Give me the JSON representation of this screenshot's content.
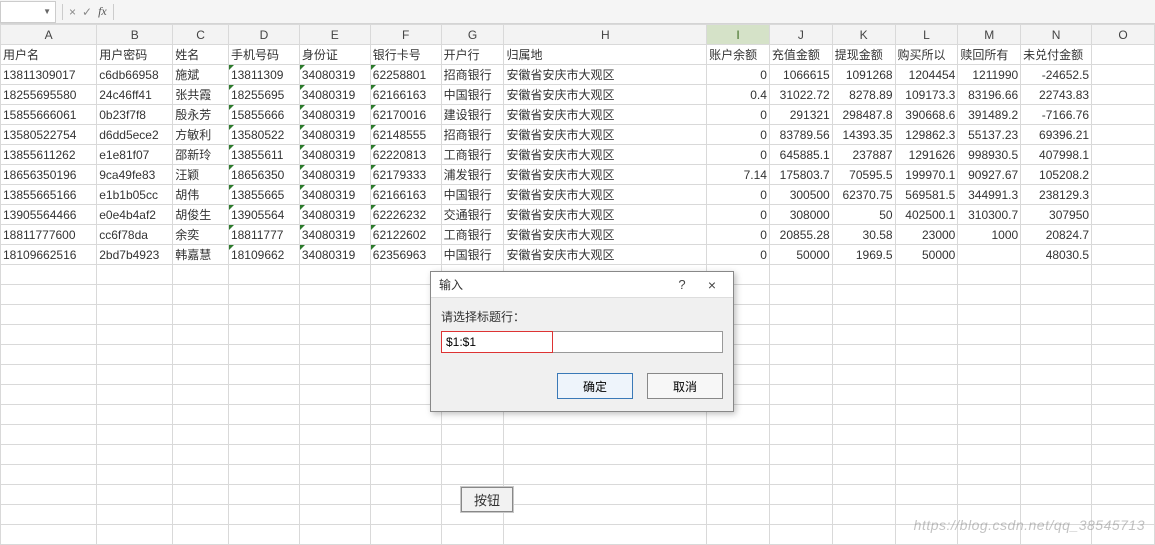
{
  "formula_bar": {
    "name_box": "",
    "fx_label": "fx",
    "cancel_glyph": "×",
    "accept_glyph": "✓"
  },
  "columns": [
    "A",
    "B",
    "C",
    "D",
    "E",
    "F",
    "G",
    "H",
    "I",
    "J",
    "K",
    "L",
    "M",
    "N",
    "O"
  ],
  "selected_column": "I",
  "headers": {
    "A": "用户名",
    "B": "用户密码",
    "C": "姓名",
    "D": "手机号码",
    "E": "身份证",
    "F": "银行卡号",
    "G": "开户行",
    "H": "归属地",
    "I": "账户余额",
    "J": "充值金额",
    "K": "提现金额",
    "L": "购买所以",
    "M": "赎回所有",
    "N": "未兑付金额"
  },
  "rows": [
    {
      "A": "13811309017",
      "B": "c6db66958",
      "C": "施斌",
      "D": "13811309",
      "E": "34080319",
      "F": "62258801",
      "G": "招商银行",
      "H": "安徽省安庆市大观区",
      "I": "0",
      "J": "1066615",
      "K": "1091268",
      "L": "1204454",
      "M": "1211990",
      "N": "-24652.5"
    },
    {
      "A": "18255695580",
      "B": "24c46ff41",
      "C": "张共霞",
      "D": "18255695",
      "E": "34080319",
      "F": "62166163",
      "G": "中国银行",
      "H": "安徽省安庆市大观区",
      "I": "0.4",
      "J": "31022.72",
      "K": "8278.89",
      "L": "109173.3",
      "M": "83196.66",
      "N": "22743.83"
    },
    {
      "A": "15855666061",
      "B": "0b23f7f8",
      "C": "殷永芳",
      "D": "15855666",
      "E": "34080319",
      "F": "62170016",
      "G": "建设银行",
      "H": "安徽省安庆市大观区",
      "I": "0",
      "J": "291321",
      "K": "298487.8",
      "L": "390668.6",
      "M": "391489.2",
      "N": "-7166.76"
    },
    {
      "A": "13580522754",
      "B": "d6dd5ece2",
      "C": "方敏利",
      "D": "13580522",
      "E": "34080319",
      "F": "62148555",
      "G": "招商银行",
      "H": "安徽省安庆市大观区",
      "I": "0",
      "J": "83789.56",
      "K": "14393.35",
      "L": "129862.3",
      "M": "55137.23",
      "N": "69396.21"
    },
    {
      "A": "13855611262",
      "B": "e1e81f07",
      "C": "邵新玲",
      "D": "13855611",
      "E": "34080319",
      "F": "62220813",
      "G": "工商银行",
      "H": "安徽省安庆市大观区",
      "I": "0",
      "J": "645885.1",
      "K": "237887",
      "L": "1291626",
      "M": "998930.5",
      "N": "407998.1"
    },
    {
      "A": "18656350196",
      "B": "9ca49fe83",
      "C": "汪颖",
      "D": "18656350",
      "E": "34080319",
      "F": "62179333",
      "G": "浦发银行",
      "H": "安徽省安庆市大观区",
      "I": "7.14",
      "J": "175803.7",
      "K": "70595.5",
      "L": "199970.1",
      "M": "90927.67",
      "N": "105208.2"
    },
    {
      "A": "13855665166",
      "B": "e1b1b05cc",
      "C": "胡伟",
      "D": "13855665",
      "E": "34080319",
      "F": "62166163",
      "G": "中国银行",
      "H": "安徽省安庆市大观区",
      "I": "0",
      "J": "300500",
      "K": "62370.75",
      "L": "569581.5",
      "M": "344991.3",
      "N": "238129.3"
    },
    {
      "A": "13905564466",
      "B": "e0e4b4af2",
      "C": "胡俊生",
      "D": "13905564",
      "E": "34080319",
      "F": "62226232",
      "G": "交通银行",
      "H": "安徽省安庆市大观区",
      "I": "0",
      "J": "308000",
      "K": "50",
      "L": "402500.1",
      "M": "310300.7",
      "N": "307950"
    },
    {
      "A": "18811777600",
      "B": "cc6f78da",
      "C": "余奕",
      "D": "18811777",
      "E": "34080319",
      "F": "62122602",
      "G": "工商银行",
      "H": "安徽省安庆市大观区",
      "I": "0",
      "J": "20855.28",
      "K": "30.58",
      "L": "23000",
      "M": "1000",
      "N": "20824.7"
    },
    {
      "A": "18109662516",
      "B": "2bd7b4923",
      "C": "韩嘉慧",
      "D": "18109662",
      "E": "34080319",
      "F": "62356963",
      "G": "中国银行",
      "H": "安徽省安庆市大观区",
      "I": "0",
      "J": "50000",
      "K": "1969.5",
      "L": "50000",
      "M": "",
      "N": "48030.5"
    }
  ],
  "embed_button": {
    "label": "按钮"
  },
  "dialog": {
    "title": "输入",
    "help_glyph": "?",
    "close_glyph": "×",
    "prompt": "请选择标题行：",
    "input_value": "$1:$1",
    "ok_label": "确定",
    "cancel_label": "取消"
  },
  "watermark": "https://blog.csdn.net/qq_38545713"
}
